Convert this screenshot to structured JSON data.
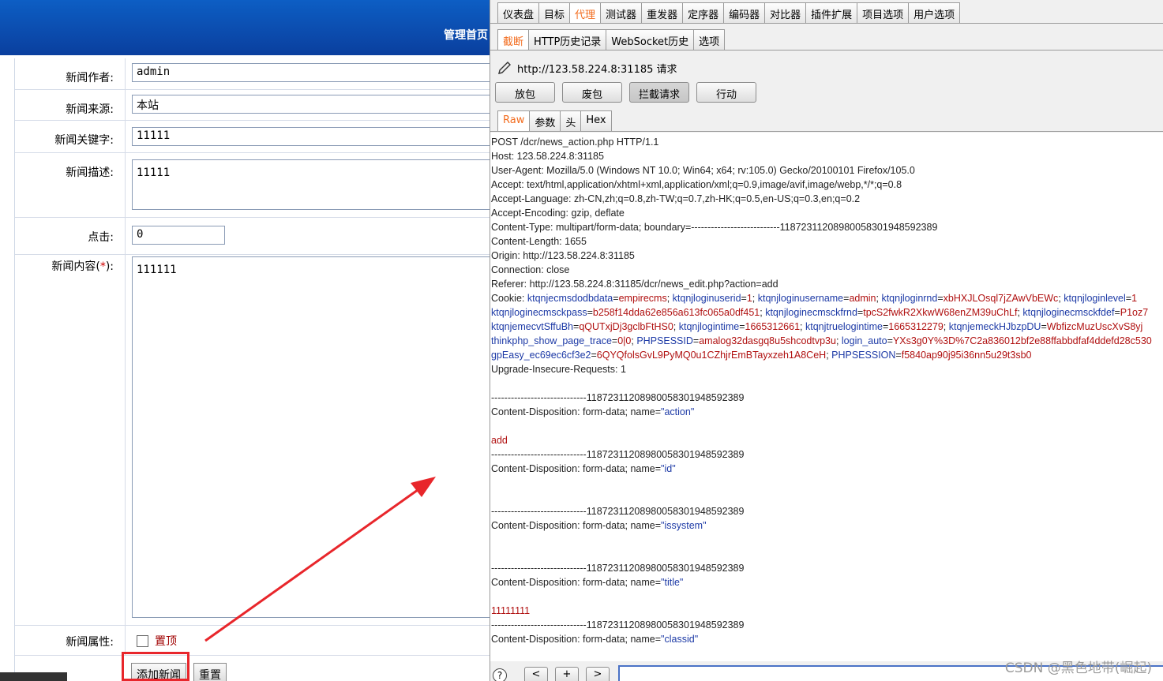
{
  "cms": {
    "header_title": "管理首页",
    "fields": {
      "author": {
        "label": "新闻作者:",
        "value": "admin"
      },
      "source": {
        "label": "新闻来源:",
        "value": "本站"
      },
      "keywords": {
        "label": "新闻关键字:",
        "value": "11111"
      },
      "description": {
        "label": "新闻描述:",
        "value": "11111"
      },
      "hits": {
        "label": "点击:",
        "value": "0"
      },
      "content": {
        "label_prefix": "新闻内容(",
        "required_mark": "*",
        "label_suffix": "):",
        "value": "111111"
      },
      "attribute": {
        "label": "新闻属性:",
        "option": "置顶"
      }
    },
    "buttons": {
      "add": "添加新闻",
      "reset": "重置"
    }
  },
  "burp": {
    "top_tabs": [
      "仪表盘",
      "目标",
      "代理",
      "测试器",
      "重发器",
      "定序器",
      "编码器",
      "对比器",
      "插件扩展",
      "项目选项",
      "用户选项"
    ],
    "active_top_tab": "代理",
    "sub_tabs": [
      "截断",
      "HTTP历史记录",
      "WebSocket历史",
      "选项"
    ],
    "active_sub_tab": "截断",
    "request_line": "http://123.58.224.8:31185 请求",
    "action_buttons": [
      "放包",
      "废包",
      "拦截请求",
      "行动"
    ],
    "pressed_button": "拦截请求",
    "view_tabs": [
      "Raw",
      "参数",
      "头",
      "Hex"
    ],
    "active_view_tab": "Raw",
    "headers": [
      "POST /dcr/news_action.php HTTP/1.1",
      "Host: 123.58.224.8:31185",
      "User-Agent: Mozilla/5.0 (Windows NT 10.0; Win64; x64; rv:105.0) Gecko/20100101 Firefox/105.0",
      "Accept: text/html,application/xhtml+xml,application/xml;q=0.9,image/avif,image/webp,*/*;q=0.8",
      "Accept-Language: zh-CN,zh;q=0.8,zh-TW;q=0.7,zh-HK;q=0.5,en-US;q=0.3,en;q=0.2",
      "Accept-Encoding: gzip, deflate",
      "Content-Type: multipart/form-data; boundary=---------------------------118723112089800583019485923­89",
      "Content-Length: 1655",
      "Origin: http://123.58.224.8:31185",
      "Connection: close",
      "Referer: http://123.58.224.8:31185/dcr/news_edit.php?action=add"
    ],
    "cookie_lines": [
      [
        {
          "t": "Cookie: ",
          "c": "plain"
        },
        {
          "t": "ktqnjecmsdodbdata",
          "c": "key"
        },
        {
          "t": "=",
          "c": "plain"
        },
        {
          "t": "empirecms",
          "c": "val"
        },
        {
          "t": "; ",
          "c": "plain"
        },
        {
          "t": "ktqnjloginuserid",
          "c": "key"
        },
        {
          "t": "=",
          "c": "plain"
        },
        {
          "t": "1",
          "c": "val"
        },
        {
          "t": "; ",
          "c": "plain"
        },
        {
          "t": "ktqnjloginusername",
          "c": "key"
        },
        {
          "t": "=",
          "c": "plain"
        },
        {
          "t": "admin",
          "c": "val"
        },
        {
          "t": "; ",
          "c": "plain"
        },
        {
          "t": "ktqnjloginrnd",
          "c": "key"
        },
        {
          "t": "=",
          "c": "plain"
        },
        {
          "t": "xbHXJLOsql7jZAwVbEWc",
          "c": "val"
        },
        {
          "t": "; ",
          "c": "plain"
        },
        {
          "t": "ktqnjloginlevel",
          "c": "key"
        },
        {
          "t": "=",
          "c": "plain"
        },
        {
          "t": "1",
          "c": "val"
        }
      ],
      [
        {
          "t": "ktqnjloginecmsckpass",
          "c": "key"
        },
        {
          "t": "=",
          "c": "plain"
        },
        {
          "t": "b258f14dda62e856a613fc065a0df451",
          "c": "val"
        },
        {
          "t": "; ",
          "c": "plain"
        },
        {
          "t": "ktqnjloginecmsckfrnd",
          "c": "key"
        },
        {
          "t": "=",
          "c": "plain"
        },
        {
          "t": "tpcS2fwkR2XkwW68enZM39uChLf",
          "c": "val"
        },
        {
          "t": "; ",
          "c": "plain"
        },
        {
          "t": "ktqnjloginecmsckfdef",
          "c": "key"
        },
        {
          "t": "=",
          "c": "plain"
        },
        {
          "t": "P1oz7",
          "c": "val"
        }
      ],
      [
        {
          "t": "ktqnjemecvtSffuBh",
          "c": "key"
        },
        {
          "t": "=",
          "c": "plain"
        },
        {
          "t": "qQUTxjDj3gclbFtHS0",
          "c": "val"
        },
        {
          "t": "; ",
          "c": "plain"
        },
        {
          "t": "ktqnjlogintime",
          "c": "key"
        },
        {
          "t": "=",
          "c": "plain"
        },
        {
          "t": "1665312661",
          "c": "val"
        },
        {
          "t": "; ",
          "c": "plain"
        },
        {
          "t": "ktqnjtruelogintime",
          "c": "key"
        },
        {
          "t": "=",
          "c": "plain"
        },
        {
          "t": "1665312279",
          "c": "val"
        },
        {
          "t": "; ",
          "c": "plain"
        },
        {
          "t": "ktqnjemeckHJbzpDU",
          "c": "key"
        },
        {
          "t": "=",
          "c": "plain"
        },
        {
          "t": "WbfizcMuzUscXvS8yj",
          "c": "val"
        }
      ],
      [
        {
          "t": "thinkphp_show_page_trace",
          "c": "key"
        },
        {
          "t": "=",
          "c": "plain"
        },
        {
          "t": "0|0",
          "c": "val"
        },
        {
          "t": "; ",
          "c": "plain"
        },
        {
          "t": "PHPSESSID",
          "c": "key"
        },
        {
          "t": "=",
          "c": "plain"
        },
        {
          "t": "amalog32dasgq8u5shcodtvp3u",
          "c": "val"
        },
        {
          "t": "; ",
          "c": "plain"
        },
        {
          "t": "login_auto",
          "c": "key"
        },
        {
          "t": "=",
          "c": "plain"
        },
        {
          "t": "YXs3g0Y%3D%7C2a836012bf2e88ffabbdfaf4ddefd28c530",
          "c": "val"
        }
      ],
      [
        {
          "t": "gpEasy_ec69ec6cf3e2",
          "c": "key"
        },
        {
          "t": "=",
          "c": "plain"
        },
        {
          "t": "6QYQfolsGvL9PyMQ0u1CZhjrEmBTayxzeh1A8CeH",
          "c": "val"
        },
        {
          "t": "; ",
          "c": "plain"
        },
        {
          "t": "PHPSESSION",
          "c": "key"
        },
        {
          "t": "=",
          "c": "plain"
        },
        {
          "t": "f5840ap90j95i36nn5u29t3sb0",
          "c": "val"
        }
      ]
    ],
    "upgrade_line": "Upgrade-Insecure-Requests: 1",
    "boundary": "-----------------------------118723112089800583019485923­89",
    "parts": [
      {
        "disp": "Content-Disposition: form-data; name=",
        "name": "\"action\"",
        "value": "add"
      },
      {
        "disp": "Content-Disposition: form-data; name=",
        "name": "\"id\"",
        "value": ""
      },
      {
        "disp": "Content-Disposition: form-data; name=",
        "name": "\"issystem\"",
        "value": ""
      },
      {
        "disp": "Content-Disposition: form-data; name=",
        "name": "\"title\"",
        "value": "11111111"
      },
      {
        "disp": "Content-Disposition: form-data; name=",
        "name": "\"classid\"",
        "value": null
      }
    ],
    "bottom": {
      "help": "?",
      "prev": "<",
      "add": "+",
      "next": ">"
    },
    "watermark": "CSDN @黑色地带(崛起)"
  },
  "colors": {
    "active_tab": "#f26b1d",
    "highlight": "#e8262b",
    "cookie_key": "#1d3aa6",
    "cookie_value": "#b01010"
  }
}
